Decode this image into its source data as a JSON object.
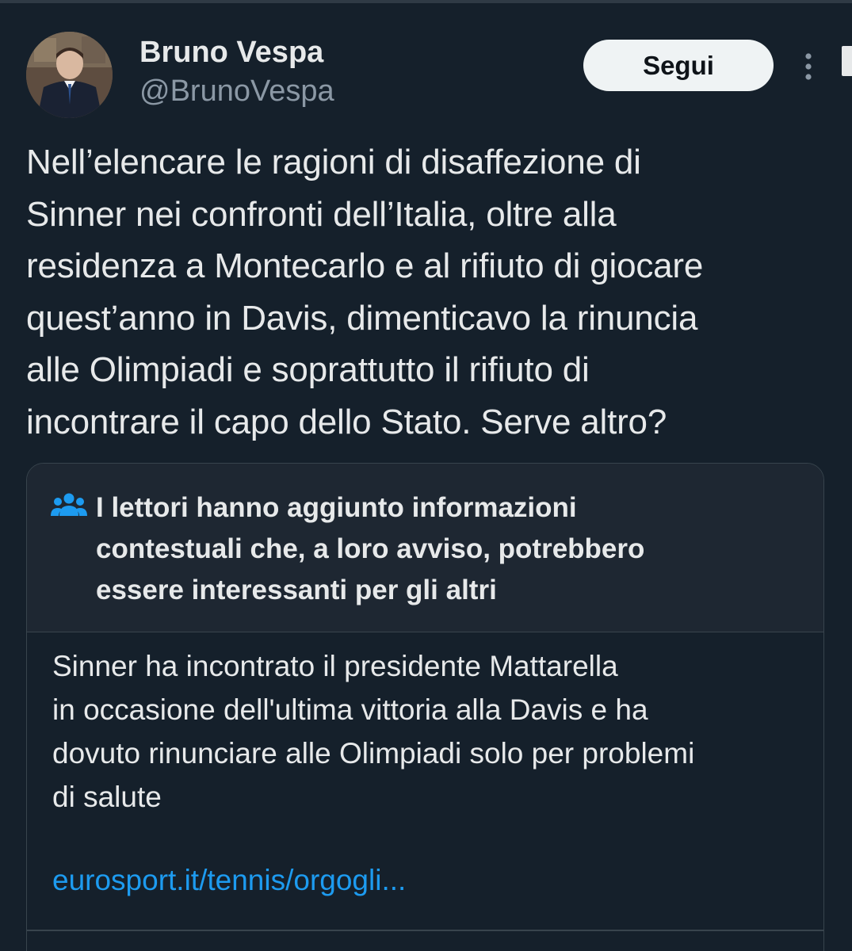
{
  "author": {
    "display_name": "Bruno Vespa",
    "handle": "@BrunoVespa"
  },
  "actions": {
    "follow_label": "Segui",
    "more_icon": "more-vertical-icon"
  },
  "tweet": {
    "text": "Nell’elencare le ragioni di disaffezione di\nSinner nei confronti dell’Italia, oltre alla\nresidenza a Montecarlo e al rifiuto di giocare\nquest’anno in Davis, dimenticavo la rinuncia\nalle Olimpiadi e soprattutto il rifiuto di\nincontrare il capo dello Stato. Serve altro?"
  },
  "community_note": {
    "icon": "people-icon",
    "title": "I lettori hanno aggiunto informazioni\ncontestuali che, a loro avviso, potrebbero\nessere interessanti per gli altri",
    "body": "Sinner ha incontrato il presidente Mattarella\nin occasione dell'ultima vittoria alla Davis e ha\ndovuto rinunciare alle Olimpiadi solo per problemi\ndi salute",
    "link": "eurosport.it/tennis/orgogli..."
  },
  "colors": {
    "background": "#15202b",
    "note_header_bg": "#1e2732",
    "border": "#38444d",
    "primary_text": "#e7e9ea",
    "secondary_text": "#8b98a5",
    "link": "#1d9bf0",
    "follow_button_bg": "#eff3f4",
    "icon_blue": "#1d9bf0"
  }
}
